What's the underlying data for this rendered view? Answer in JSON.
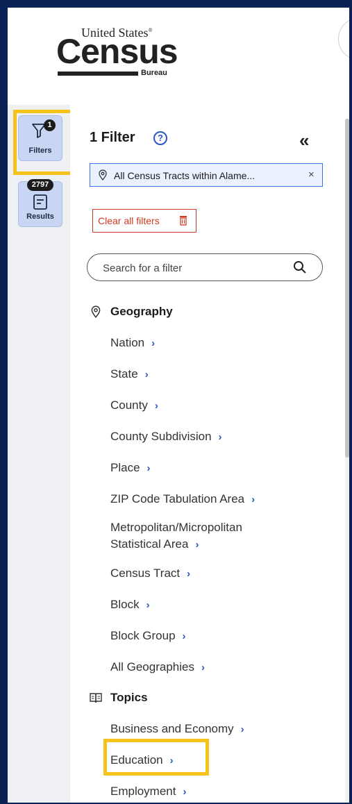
{
  "logo": {
    "line1": "United States",
    "reg": "®",
    "line2": "Census",
    "line3": "Bureau"
  },
  "rail": {
    "filters": {
      "label": "Filters",
      "badge": "1"
    },
    "results": {
      "label": "Results",
      "badge": "2797"
    }
  },
  "panel": {
    "title": "1 Filter",
    "help": "?",
    "collapse": "«",
    "chip": {
      "text": "All Census Tracts within Alame...",
      "remove": "×"
    },
    "clear_label": "Clear all filters",
    "search_placeholder": "Search for a filter",
    "geography": {
      "label": "Geography",
      "items": [
        "Nation",
        "State",
        "County",
        "County Subdivision",
        "Place",
        "ZIP Code Tabulation Area",
        "Metropolitan/Micropolitan",
        "Statistical Area",
        "Census Tract",
        "Block",
        "Block Group",
        "All Geographies"
      ]
    },
    "topics": {
      "label": "Topics",
      "items": [
        "Business and Economy",
        "Education",
        "Employment"
      ]
    }
  },
  "colors": {
    "accent": "#2b55c4",
    "highlight": "#f6c21c",
    "danger": "#cf3b22",
    "frame": "#0b2257"
  }
}
